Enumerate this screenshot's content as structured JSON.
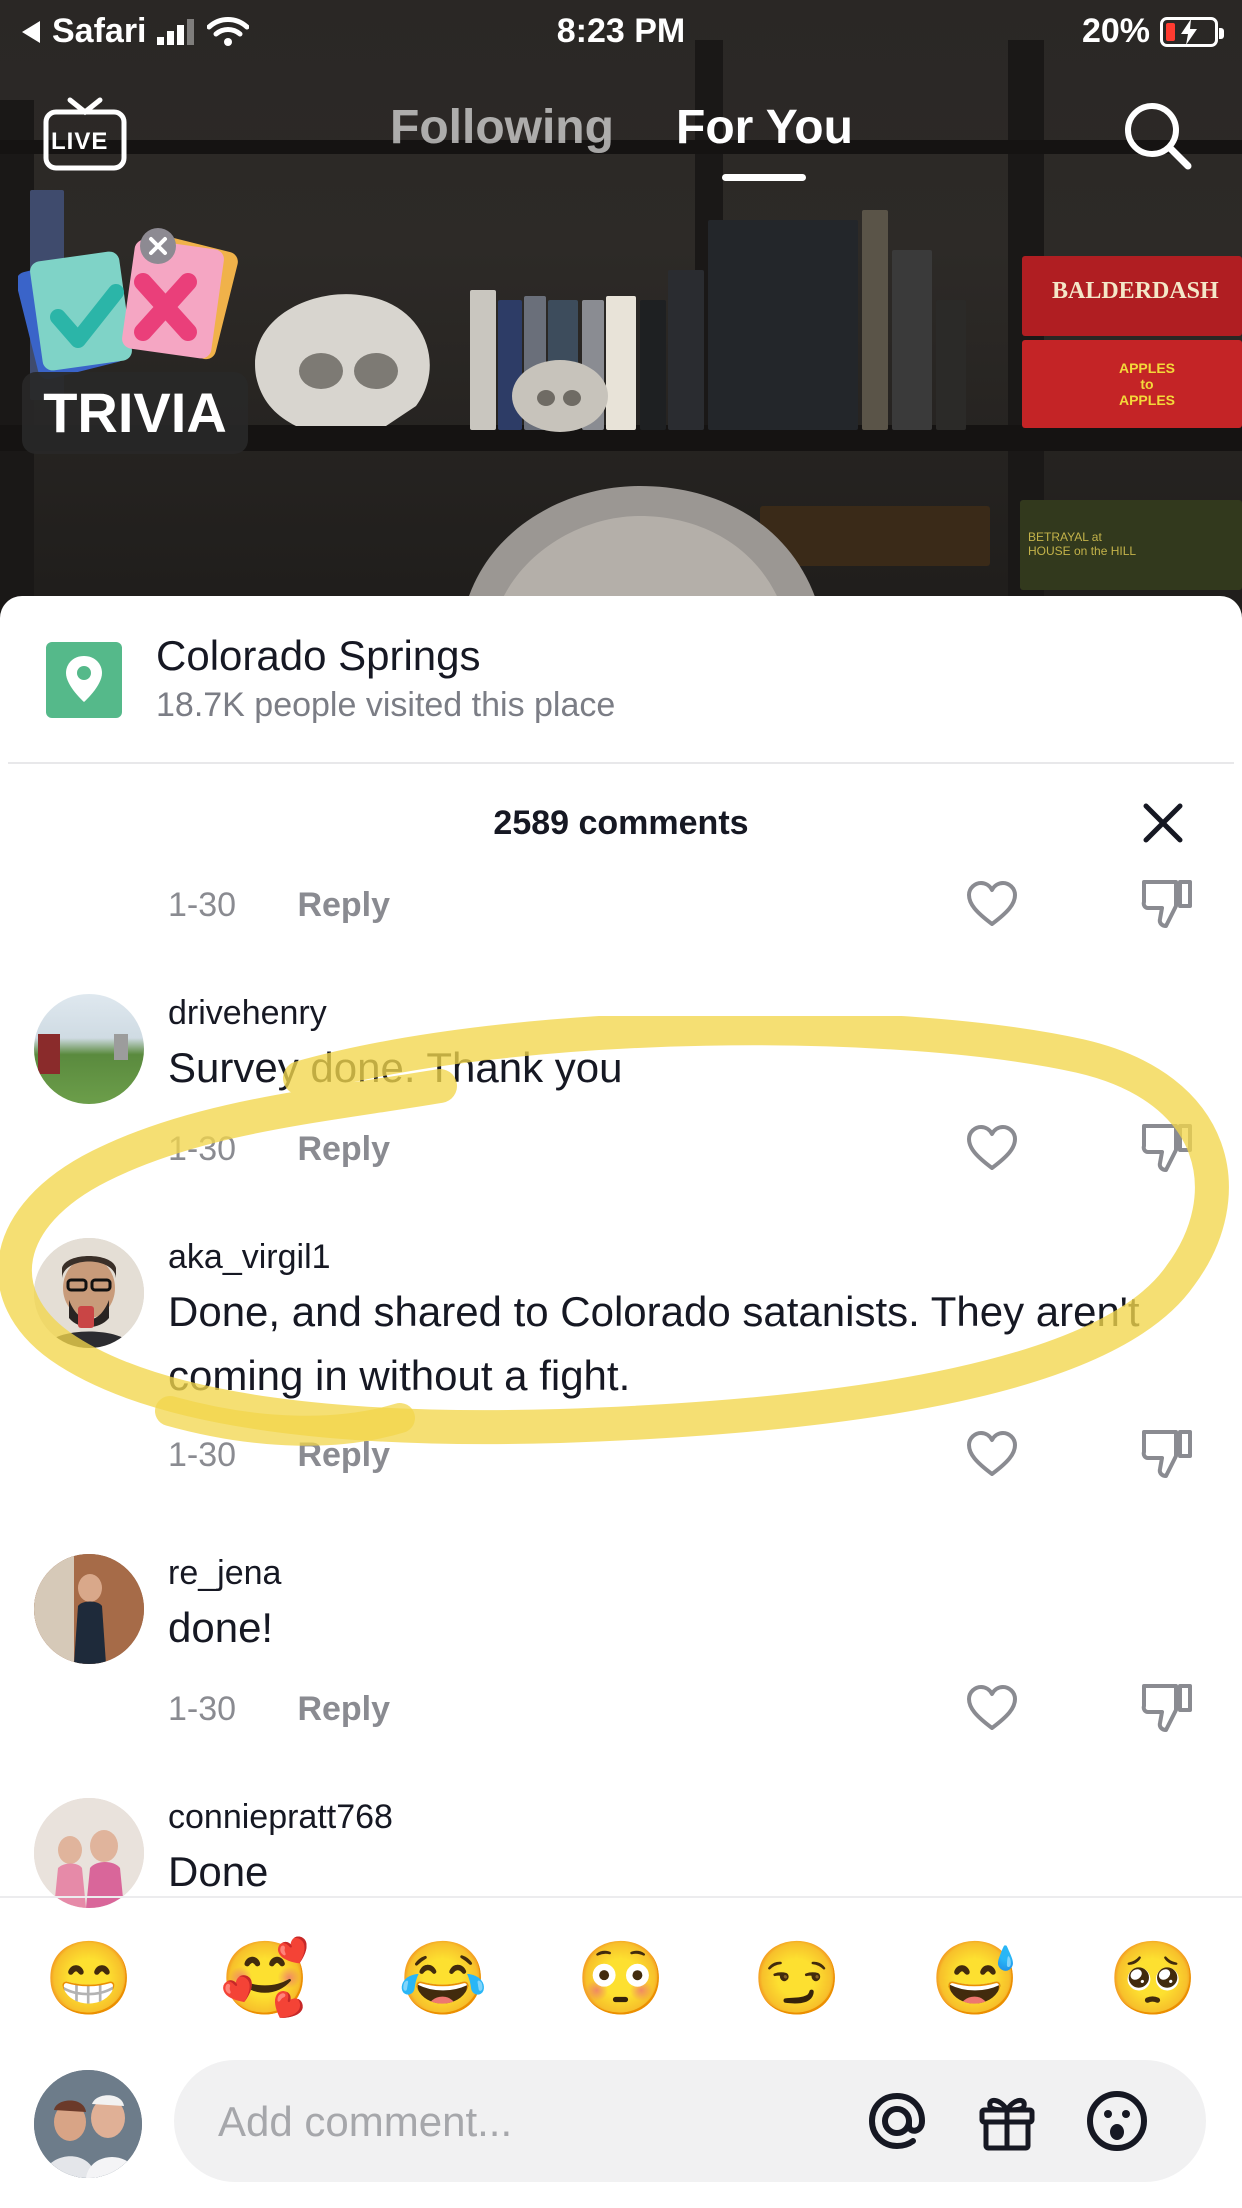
{
  "status_bar": {
    "back_app": "Safari",
    "time": "8:23 PM",
    "battery": "20%",
    "battery_level": 0.2
  },
  "top_nav": {
    "live_label": "LIVE",
    "tabs": [
      {
        "label": "Following",
        "active": false
      },
      {
        "label": "For You",
        "active": true
      }
    ]
  },
  "badge": {
    "label": "TRIVIA"
  },
  "video_props": {
    "game_box_1": "BALDERDASH",
    "game_box_2": "APPLES to APPLES",
    "game_box_3": "BETRAYAL at HOUSE on the HILL"
  },
  "location": {
    "name": "Colorado Springs",
    "visitors": "18.7K people visited this place"
  },
  "comments": {
    "count_label": "2589 comments",
    "reply_label": "Reply",
    "items": [
      {
        "username": "",
        "text": "",
        "date": "1-30",
        "partial": true
      },
      {
        "username": "drivehenry",
        "text": "Survey done. Thank you",
        "date": "1-30"
      },
      {
        "username": "aka_virgil1",
        "text": "Done, and shared to Colorado satanists. They aren't coming in without a fight.",
        "date": "1-30",
        "highlighted": true
      },
      {
        "username": "re_jena",
        "text": "done!",
        "date": "1-30"
      },
      {
        "username": "conniepratt768",
        "text": "Done",
        "date": ""
      }
    ]
  },
  "emoji_bar": [
    "😁",
    "🥰",
    "😂",
    "😳",
    "😏",
    "😅",
    "🥺"
  ],
  "composer": {
    "placeholder": "Add comment...",
    "icons": [
      "at-icon",
      "gift-icon",
      "emoji-icon"
    ]
  },
  "colors": {
    "highlight": "#f2d64b",
    "location_pin": "#55b98a",
    "battery_low": "#ff3b30"
  }
}
